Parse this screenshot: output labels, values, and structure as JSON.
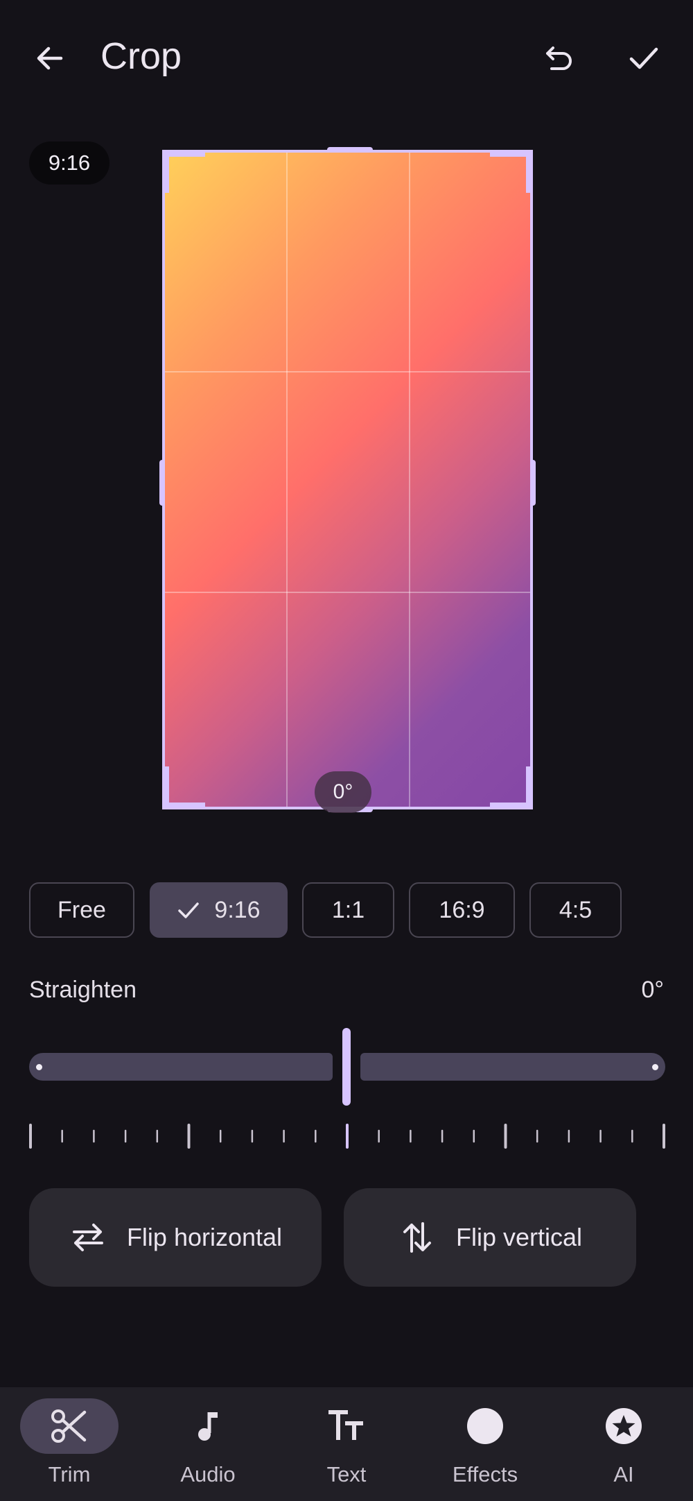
{
  "header": {
    "title": "Crop",
    "back_icon": "arrow-left-icon",
    "undo_icon": "undo-icon",
    "done_icon": "check-icon"
  },
  "preview": {
    "ratio_badge": "9:16",
    "angle_chip": "0°"
  },
  "aspect_options": [
    {
      "label": "Free",
      "selected": false
    },
    {
      "label": "9:16",
      "selected": true
    },
    {
      "label": "1:1",
      "selected": false
    },
    {
      "label": "16:9",
      "selected": false
    },
    {
      "label": "4:5",
      "selected": false
    }
  ],
  "straighten": {
    "label": "Straighten",
    "value": "0°",
    "angle_degrees": 0
  },
  "flip": {
    "horizontal_label": "Flip horizontal",
    "vertical_label": "Flip vertical"
  },
  "bottom_nav": [
    {
      "label": "Trim",
      "icon": "scissors-icon",
      "active": true
    },
    {
      "label": "Audio",
      "icon": "music-note-icon",
      "active": false
    },
    {
      "label": "Text",
      "icon": "text-size-icon",
      "active": false
    },
    {
      "label": "Effects",
      "icon": "circle-icon",
      "active": false
    },
    {
      "label": "AI",
      "icon": "star-badge-icon",
      "active": false
    }
  ],
  "colors": {
    "background": "#141218",
    "accent": "#d7c4ff",
    "surface": "#2b2930",
    "selected_chip": "#4a4458"
  }
}
